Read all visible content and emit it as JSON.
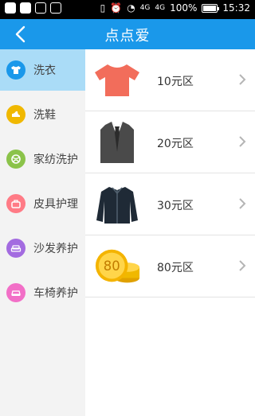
{
  "status": {
    "battery_pct": "100%",
    "time": "15:32",
    "net_type": "4G",
    "net_type_small": "4G"
  },
  "header": {
    "title": "点点爱"
  },
  "sidebar": {
    "items": [
      {
        "label": "洗衣",
        "active": true,
        "color": "#1a98ea",
        "icon": "shirt-icon"
      },
      {
        "label": "洗鞋",
        "active": false,
        "color": "#f0b800",
        "icon": "shoe-icon"
      },
      {
        "label": "家纺洗护",
        "active": false,
        "color": "#8bc34a",
        "icon": "ball-icon"
      },
      {
        "label": "皮具护理",
        "active": false,
        "color": "#ff7b86",
        "icon": "bag-icon"
      },
      {
        "label": "沙发养护",
        "active": false,
        "color": "#a36be0",
        "icon": "sofa-icon"
      },
      {
        "label": "车椅养护",
        "active": false,
        "color": "#f26fc7",
        "icon": "car-icon"
      }
    ]
  },
  "items": [
    {
      "label": "10元区",
      "icon": "tshirt-icon"
    },
    {
      "label": "20元区",
      "icon": "suit-vest-icon"
    },
    {
      "label": "30元区",
      "icon": "jacket-icon"
    },
    {
      "label": "80元区",
      "icon": "coin-icon",
      "coin_text": "80"
    }
  ],
  "colors": {
    "accent": "#1a98ea",
    "active_bg": "#aadcf7"
  }
}
